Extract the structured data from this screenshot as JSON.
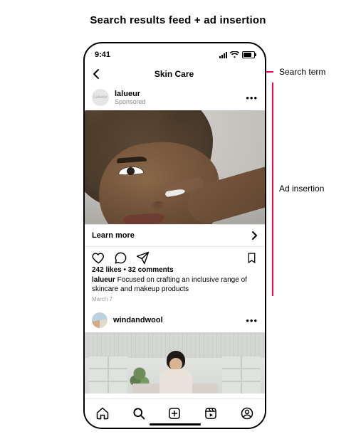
{
  "page_title": "Search results feed + ad insertion",
  "annotations": {
    "search_term_label": "Search term",
    "ad_insertion_label": "Ad insertion"
  },
  "status_bar": {
    "time": "9:41"
  },
  "search_header": {
    "term": "Skin Care"
  },
  "ad_post": {
    "avatar_text": "Lalueur",
    "account": "lalueur",
    "sub": "Sponsored",
    "cta": "Learn more",
    "likes_line": "242 likes • 32 comments",
    "caption_account": "lalueur",
    "caption_text": "Focused on crafting an inclusive range of skincare and makeup products",
    "date": "March 7"
  },
  "second_post": {
    "account": "windandwool"
  }
}
